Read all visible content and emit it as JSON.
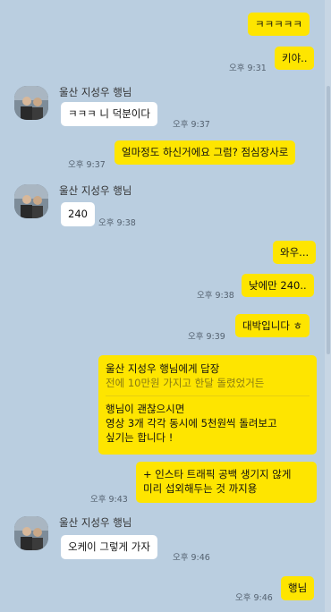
{
  "chat": {
    "colors": {
      "background": "#bacee0",
      "mine_bubble": "#fee500",
      "their_bubble": "#ffffff"
    },
    "messages": [
      {
        "id": "m1",
        "from": "me",
        "text": "ㅋㅋㅋㅋㅋ"
      },
      {
        "id": "m2",
        "from": "me",
        "text": "키야..",
        "time": "오후 9:31"
      },
      {
        "id": "m3",
        "from": "other",
        "sender": "울산 지성우 행님",
        "text": "ㅋㅋㅋ 니 덕분이다",
        "time": "오후 9:37"
      },
      {
        "id": "m4",
        "from": "me",
        "text": "얼마정도 하신거에요 그럼? 점심장사로",
        "time": "오후 9:37"
      },
      {
        "id": "m5",
        "from": "other",
        "sender": "울산 지성우 행님",
        "text": "240",
        "time": "오후 9:38"
      },
      {
        "id": "m6",
        "from": "me",
        "text": "와우..."
      },
      {
        "id": "m7",
        "from": "me",
        "text": "낮에만 240..",
        "time": "오후 9:38"
      },
      {
        "id": "m8",
        "from": "me",
        "text": "대박입니다 ㅎ",
        "time": "오후 9:39"
      },
      {
        "id": "m9",
        "from": "me",
        "reply_to": {
          "title": "울산 지성우 행님에게 답장",
          "text": "전에 10만원 가지고 한달 돌렸었거든"
        },
        "lines": [
          "행님이 괜찮으시면",
          "영상 3개 각각 동시에 5천원씩 돌려보고",
          "싶기는 합니다 !"
        ]
      },
      {
        "id": "m10",
        "from": "me",
        "lines": [
          "+ 인스타 트래픽 공백 생기지 않게",
          "미리 섭외해두는 것 까지용"
        ],
        "time": "오후 9:43"
      },
      {
        "id": "m11",
        "from": "other",
        "sender": "울산 지성우 행님",
        "text": "오케이 그렇게 가자",
        "time": "오후 9:46"
      },
      {
        "id": "m12",
        "from": "me",
        "text": "행님",
        "time": "오후 9:46"
      }
    ]
  }
}
